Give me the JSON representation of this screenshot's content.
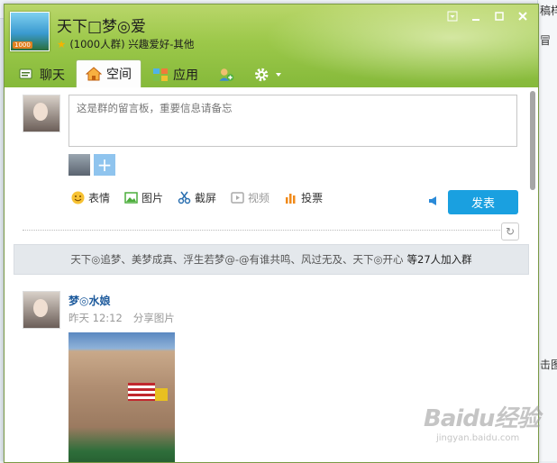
{
  "background": {
    "right_fragments": [
      "稿样金",
      "冒",
      "击图"
    ]
  },
  "window": {
    "group_name": "天下□梦◎爱",
    "group_info": "(1000人群) 兴趣爱好-其他",
    "avatar_badge": "1000",
    "controls": [
      "dropdown",
      "minimize",
      "maximize",
      "close"
    ]
  },
  "tabs": [
    {
      "label": "聊天",
      "icon": "chat-icon",
      "active": false
    },
    {
      "label": "空间",
      "icon": "home-icon",
      "active": true
    },
    {
      "label": "应用",
      "icon": "apps-icon",
      "active": false
    }
  ],
  "compose": {
    "placeholder": "这是群的留言板，重要信息请备忘",
    "tools": [
      {
        "label": "表情",
        "icon": "emoji-icon"
      },
      {
        "label": "图片",
        "icon": "picture-icon"
      },
      {
        "label": "截屏",
        "icon": "scissors-icon"
      },
      {
        "label": "视频",
        "icon": "video-icon"
      },
      {
        "label": "投票",
        "icon": "vote-icon"
      }
    ],
    "post_label": "发表"
  },
  "joined": {
    "names": "天下◎追梦、美梦成真、浮生若梦@-@有谁共鸣、风过无及、天下◎开心",
    "count": "等27人加入群"
  },
  "feed": [
    {
      "name": "梦◎水娘",
      "time": "昨天 12:12",
      "action": "分享图片"
    }
  ],
  "watermark": {
    "title": "Baidu经验",
    "url": "jingyan.baidu.com"
  }
}
